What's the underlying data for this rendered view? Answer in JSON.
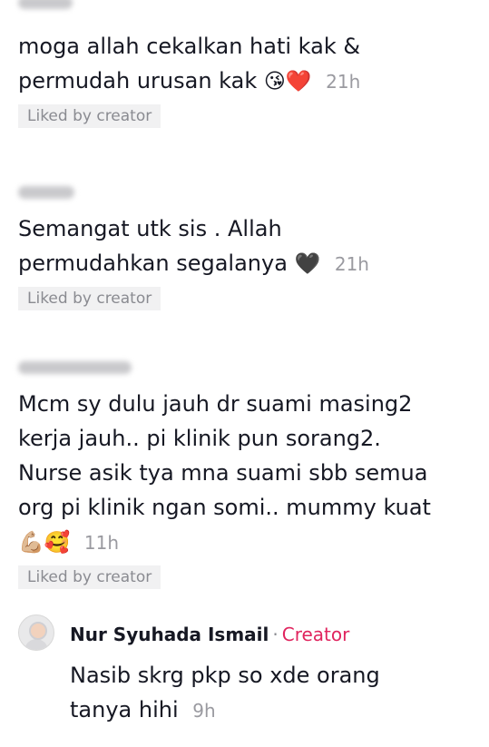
{
  "comments": [
    {
      "text_line1": "moga allah cekalkan hati kak &",
      "text_line2": "permudah urusan kak",
      "emoji": "😘❤️",
      "time": "21h",
      "liked_label": "Liked by creator"
    },
    {
      "text_line1": "Semangat utk sis . Allah",
      "text_line2": "permudahkan segalanya",
      "emoji": "🖤",
      "time": "21h",
      "liked_label": "Liked by creator"
    },
    {
      "text_line1": "Mcm sy dulu jauh dr suami masing2",
      "text_line2": "kerja jauh.. pi klinik pun sorang2.",
      "text_line3": "Nurse asik tya mna suami sbb semua",
      "text_line4": "org pi klinik ngan somi.. mummy kuat",
      "emoji": "💪🏼🥰",
      "time": "11h",
      "liked_label": "Liked by creator"
    }
  ],
  "reply": {
    "author": "Nur Syuhada Ismail",
    "separator": "·",
    "badge": "Creator",
    "text_line1": "Nasib skrg pkp so xde orang",
    "text_line2": "tanya hihi",
    "time": "9h"
  },
  "colors": {
    "creator_badge": "#e0245e",
    "timestamp": "#9a9aa0",
    "liked_bg": "#f1f1f2"
  }
}
